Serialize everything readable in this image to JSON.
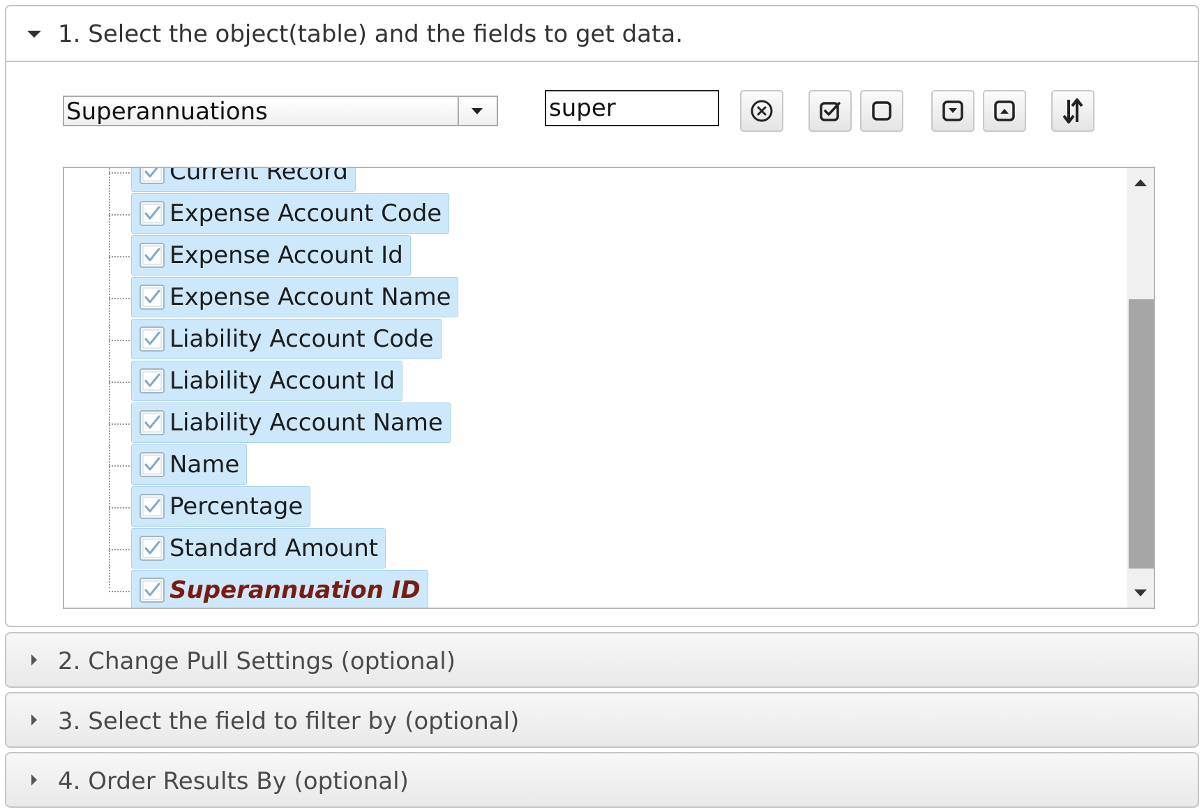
{
  "sections": [
    {
      "label": "1. Select the object(table) and the fields to get data.",
      "expanded": true
    },
    {
      "label": "2. Change Pull Settings (optional)",
      "expanded": false
    },
    {
      "label": "3. Select the field to filter by (optional)",
      "expanded": false
    },
    {
      "label": "4. Order Results By (optional)",
      "expanded": false
    }
  ],
  "object_select": {
    "value": "Superannuations"
  },
  "search": {
    "value": "super"
  },
  "toolbar": {
    "buttons": [
      {
        "icon": "clear-circle-x-icon"
      },
      {
        "icon": "check-all-icon"
      },
      {
        "icon": "uncheck-all-icon"
      },
      {
        "icon": "expand-all-icon"
      },
      {
        "icon": "collapse-all-icon"
      },
      {
        "icon": "sort-icon"
      }
    ]
  },
  "fields": [
    {
      "label": "Current Record",
      "checked": true
    },
    {
      "label": "Expense Account Code",
      "checked": true
    },
    {
      "label": "Expense Account Id",
      "checked": true
    },
    {
      "label": "Expense Account Name",
      "checked": true
    },
    {
      "label": "Liability Account Code",
      "checked": true
    },
    {
      "label": "Liability Account Id",
      "checked": true
    },
    {
      "label": "Liability Account Name",
      "checked": true
    },
    {
      "label": "Name",
      "checked": true
    },
    {
      "label": "Percentage",
      "checked": true
    },
    {
      "label": "Standard Amount",
      "checked": true
    },
    {
      "label": "Superannuation ID",
      "checked": true,
      "key": true
    }
  ],
  "colors": {
    "node_highlight": "#cde8fb",
    "key_field_text": "#7a1b10"
  }
}
